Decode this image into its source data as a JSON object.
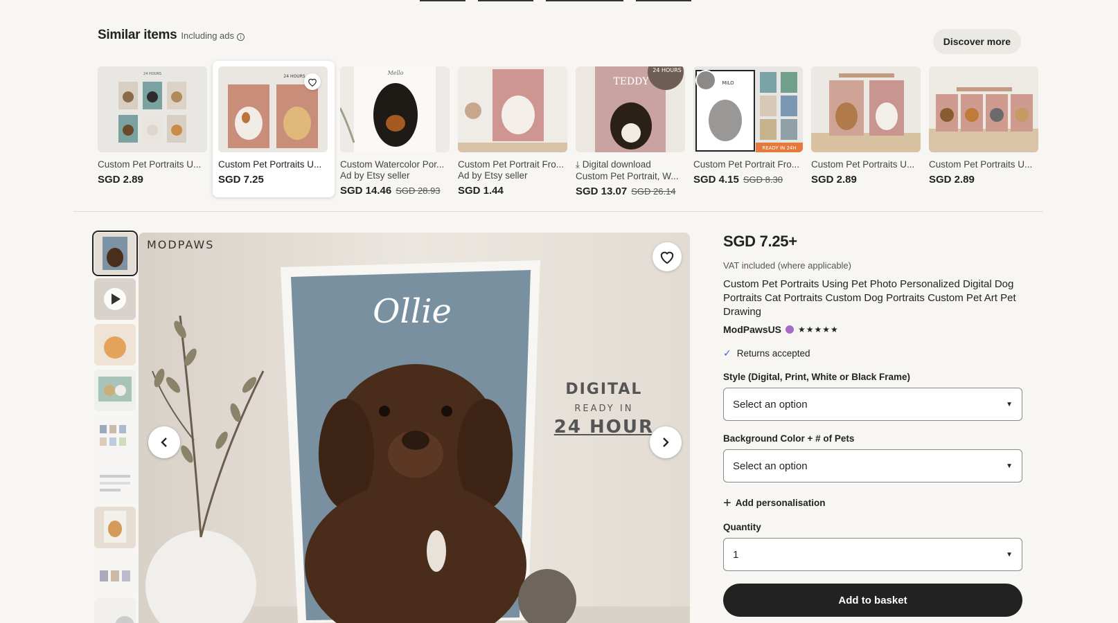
{
  "similar": {
    "title": "Similar items",
    "ads_label": "Including ads",
    "info_icon": "ⓘ",
    "discover_label": "Discover more",
    "cards": [
      {
        "title": "Custom Pet Portraits U...",
        "sub": "",
        "price": "SGD 2.89",
        "old_price": "",
        "download": ""
      },
      {
        "title": "Custom Pet Portraits U...",
        "sub": "",
        "price": "SGD 7.25",
        "old_price": "",
        "download": ""
      },
      {
        "title": "Custom Watercolor Por...",
        "sub": "Ad by Etsy seller",
        "price": "SGD 14.46",
        "old_price": "SGD 28.93",
        "download": ""
      },
      {
        "title": "Custom Pet Portrait Fro...",
        "sub": "Ad by Etsy seller",
        "price": "SGD 1.44",
        "old_price": "",
        "download": ""
      },
      {
        "title": "Custom Pet Portrait, W...",
        "sub": "",
        "price": "SGD 13.07",
        "old_price": "SGD 26.14",
        "download": "Digital download"
      },
      {
        "title": "Custom Pet Portrait Fro...",
        "sub": "",
        "price": "SGD 4.15",
        "old_price": "SGD 8.30",
        "download": ""
      },
      {
        "title": "Custom Pet Portraits U...",
        "sub": "",
        "price": "SGD 2.89",
        "old_price": "",
        "download": ""
      },
      {
        "title": "Custom Pet Portraits U...",
        "sub": "",
        "price": "SGD 2.89",
        "old_price": "",
        "download": ""
      }
    ],
    "thumb_text": {
      "card1_top": "24 HOURS",
      "card2_top": "24 HOURS",
      "card3_name": "Mello",
      "card5_name": "TEDDY",
      "card5_badge": "24 HOURS",
      "card6_name": "MILO",
      "card6_badge": "READY IN 24H"
    }
  },
  "gallery": {
    "brand": "MODPAWS",
    "pet_name": "Ollie",
    "overlay_line1": "DIGITAL",
    "overlay_line2": "READY IN",
    "overlay_line3": "24 HOUR",
    "prev_icon": "chevron-left-icon",
    "next_icon": "chevron-right-icon"
  },
  "product": {
    "price": "SGD 7.25+",
    "vat": "VAT included (where applicable)",
    "title": "Custom Pet Portraits Using Pet Photo Personalized Digital Dog Portraits Cat Portraits Custom Dog Portraits Custom Pet Art Pet Drawing",
    "shop_name": "ModPawsUS",
    "rating_stars": "★★★★★",
    "returns": "Returns accepted",
    "style_label": "Style (Digital, Print, White or Black Frame)",
    "style_value": "Select an option",
    "bg_label": "Background Color + # of Pets",
    "bg_value": "Select an option",
    "add_personalisation": "Add personalisation",
    "quantity_label": "Quantity",
    "quantity_value": "1",
    "add_to_basket": "Add to basket"
  }
}
